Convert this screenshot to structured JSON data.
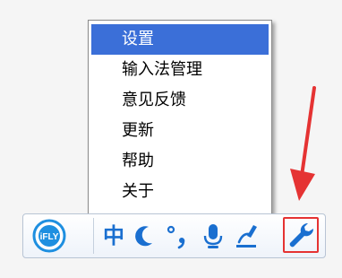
{
  "menu": {
    "items": [
      {
        "label": "设置",
        "selected": true
      },
      {
        "label": "输入法管理",
        "selected": false
      },
      {
        "label": "意见反馈",
        "selected": false
      },
      {
        "label": "更新",
        "selected": false
      },
      {
        "label": "帮助",
        "selected": false
      },
      {
        "label": "关于",
        "selected": false
      }
    ]
  },
  "imebar": {
    "logo_text": "iFLY",
    "language_mode": "中",
    "buttons": [
      {
        "icon": "half-width-moon-icon"
      },
      {
        "icon": "punctuation-icon"
      },
      {
        "icon": "microphone-icon"
      },
      {
        "icon": "handwriting-icon"
      },
      {
        "icon": "wrench-settings-icon"
      }
    ]
  },
  "colors": {
    "accent": "#1a6fd0",
    "menu_selected": "#3b6fd8",
    "annotation": "#e53333"
  }
}
